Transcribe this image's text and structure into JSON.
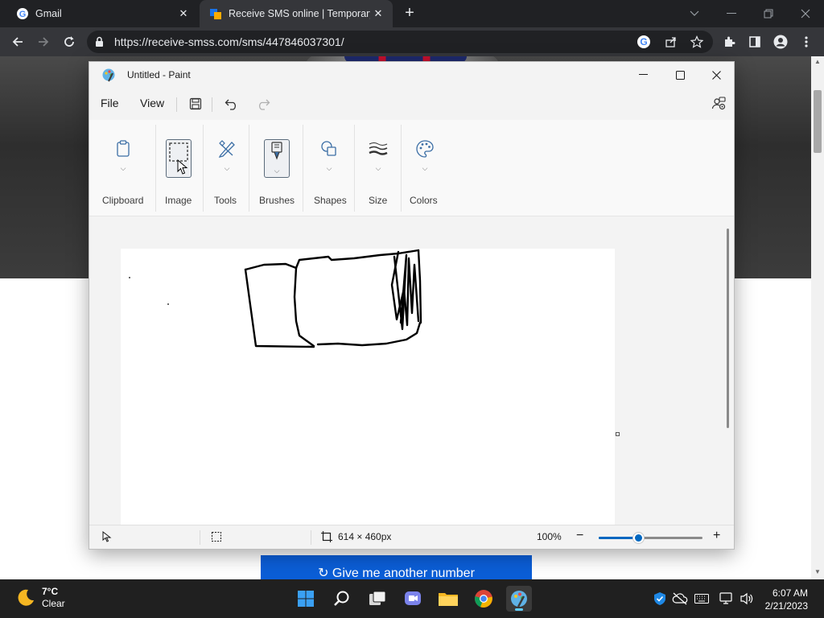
{
  "browser": {
    "tabs": [
      {
        "title": "Gmail",
        "active": false
      },
      {
        "title": "Receive SMS online | Temporary",
        "active": true
      }
    ],
    "url": "https://receive-smss.com/sms/447846037301/"
  },
  "page": {
    "give_button": "↻ Give me another number"
  },
  "paint": {
    "title": "Untitled - Paint",
    "menu": {
      "file": "File",
      "view": "View"
    },
    "groups": [
      {
        "label": "Clipboard",
        "icon": "clipboard-icon"
      },
      {
        "label": "Image",
        "icon": "select-rectangle-icon"
      },
      {
        "label": "Tools",
        "icon": "pencil-eraser-icon"
      },
      {
        "label": "Brushes",
        "icon": "brush-icon"
      },
      {
        "label": "Shapes",
        "icon": "shapes-icon"
      },
      {
        "label": "Size",
        "icon": "line-size-icon"
      },
      {
        "label": "Colors",
        "icon": "palette-icon"
      }
    ],
    "status": {
      "canvas_size": "614 × 460px",
      "zoom": "100%",
      "zoom_level": 0.38
    }
  },
  "taskbar": {
    "weather": {
      "temp": "7°C",
      "condition": "Clear"
    },
    "time": "6:07 AM",
    "date": "2/21/2023"
  },
  "colors": {
    "chrome_dark": "#202124",
    "chrome_toolbar": "#35363a",
    "accent": "#0067c0",
    "give_button": "#0b5ed7"
  }
}
